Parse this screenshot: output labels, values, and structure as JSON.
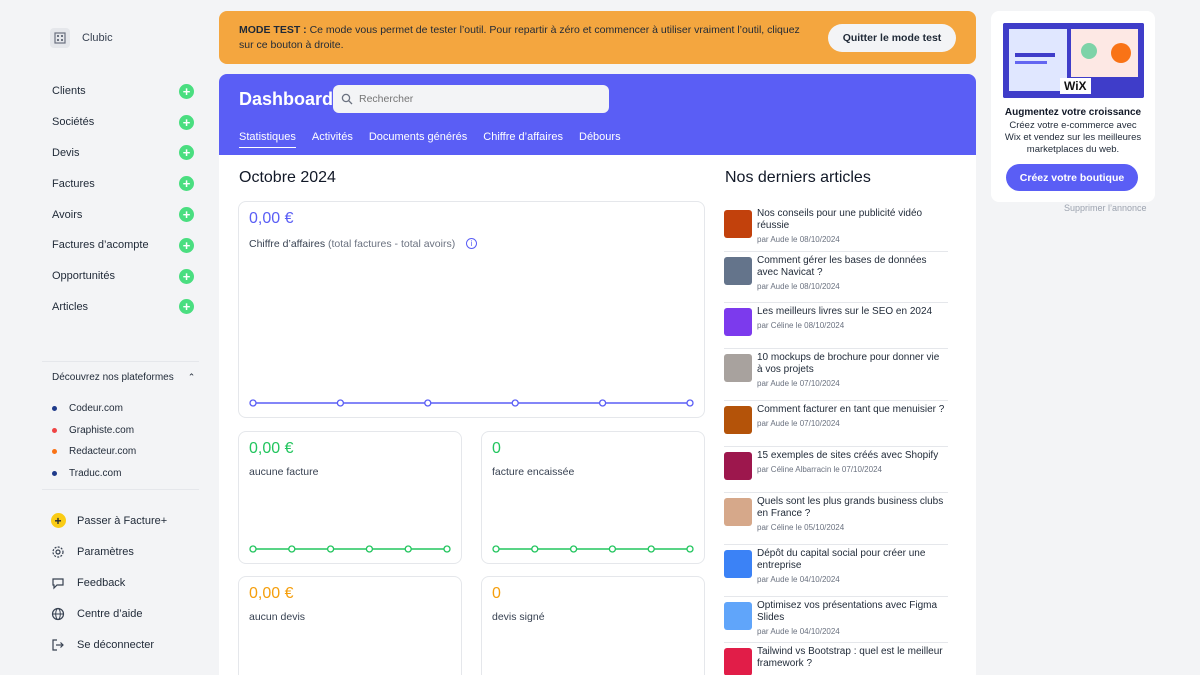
{
  "app": {
    "name": "Clubic"
  },
  "sidebar": {
    "items": [
      {
        "label": "Clients"
      },
      {
        "label": "Sociétés"
      },
      {
        "label": "Devis"
      },
      {
        "label": "Factures"
      },
      {
        "label": "Avoirs"
      },
      {
        "label": "Factures d’acompte"
      },
      {
        "label": "Opportunités"
      },
      {
        "label": "Articles"
      }
    ],
    "platforms_title": "Découvrez nos plateformes",
    "platforms": [
      {
        "label": "Codeur.com",
        "color": "#1e3a8a"
      },
      {
        "label": "Graphiste.com",
        "color": "#ef4444"
      },
      {
        "label": "Redacteur.com",
        "color": "#f97316"
      },
      {
        "label": "Traduc.com",
        "color": "#1e3a8a"
      }
    ],
    "bottom": [
      {
        "label": "Passer à Facture+",
        "icon": "star-icon"
      },
      {
        "label": "Paramètres",
        "icon": "gear-icon"
      },
      {
        "label": "Feedback",
        "icon": "chat-icon"
      },
      {
        "label": "Centre d’aide",
        "icon": "globe-icon"
      },
      {
        "label": "Se déconnecter",
        "icon": "logout-icon"
      }
    ]
  },
  "banner": {
    "prefix": "MODE TEST :",
    "text": "Ce mode vous permet de tester l’outil. Pour repartir à zéro et commencer à utiliser vraiment l’outil, cliquez sur ce bouton à droite.",
    "button": "Quitter le mode test"
  },
  "header": {
    "title": "Dashboard",
    "search_placeholder": "Rechercher",
    "tabs": [
      "Statistiques",
      "Activités",
      "Documents générés",
      "Chiffre d’affaires",
      "Débours"
    ],
    "active_tab": "Statistiques"
  },
  "stats": {
    "month": "Octobre 2024",
    "revenue": {
      "value": "0,00 €",
      "label": "Chiffre d’affaires",
      "sub": "(total factures - total avoirs)"
    },
    "invoices": {
      "value": "0,00 €",
      "label": "aucune facture"
    },
    "paid": {
      "value": "0",
      "label": "facture encaissée"
    },
    "quotes": {
      "value": "0,00 €",
      "label": "aucun devis"
    },
    "signed": {
      "value": "0",
      "label": "devis signé"
    },
    "colors": {
      "revenue": "#5a5ef5",
      "green": "#22c55e",
      "orange": "#f59e0b"
    }
  },
  "articles": {
    "title": "Nos derniers articles",
    "items": [
      {
        "title": "Nos conseils pour une publicité vidéo réussie",
        "meta": "par Aude le 08/10/2024",
        "thumb": "#c2410c"
      },
      {
        "title": "Comment gérer les bases de données avec Navicat ?",
        "meta": "par Aude le 08/10/2024",
        "thumb": "#64748b"
      },
      {
        "title": "Les meilleurs livres sur le SEO en 2024",
        "meta": "par Céline le 08/10/2024",
        "thumb": "#7c3aed"
      },
      {
        "title": "10 mockups de brochure pour donner vie à vos projets",
        "meta": "par Aude le 07/10/2024",
        "thumb": "#a8a29e"
      },
      {
        "title": "Comment facturer en tant que menuisier ?",
        "meta": "par Aude le 07/10/2024",
        "thumb": "#b45309"
      },
      {
        "title": "15 exemples de sites créés avec Shopify",
        "meta": "par Céline Albarracin le 07/10/2024",
        "thumb": "#9d174d"
      },
      {
        "title": "Quels sont les plus grands business clubs en France ?",
        "meta": "par Céline le 05/10/2024",
        "thumb": "#d6a88a"
      },
      {
        "title": "Dépôt du capital social pour créer une entreprise",
        "meta": "par Aude le 04/10/2024",
        "thumb": "#3b82f6"
      },
      {
        "title": "Optimisez vos présentations avec Figma Slides",
        "meta": "par Aude le 04/10/2024",
        "thumb": "#60a5fa"
      },
      {
        "title": "Tailwind vs Bootstrap : quel est le meilleur framework ?",
        "meta": "",
        "thumb": "#e11d48"
      }
    ]
  },
  "ad": {
    "brand": "WiX",
    "title": "Augmentez votre croissance",
    "text": "Créez votre e-commerce avec Wix et vendez sur les meilleures marketplaces du web.",
    "button": "Créez votre boutique",
    "remove": "Supprimer l’annonce"
  }
}
